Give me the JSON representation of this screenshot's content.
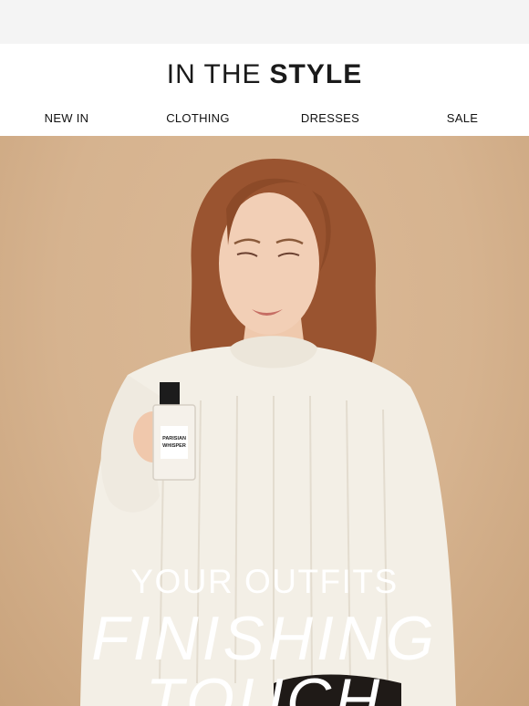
{
  "brand": {
    "logo_light": "IN THE",
    "logo_bold": "STYLE"
  },
  "nav": {
    "items": [
      "NEW IN",
      "CLOTHING",
      "DRESSES",
      "SALE"
    ]
  },
  "product": {
    "label_line1": "PARISIAN",
    "label_line2": "WHISPER"
  },
  "hero": {
    "headline_line1": "YOUR OUTFITS",
    "headline_line2": "FINISHING",
    "headline_line3": "TOUCH"
  },
  "colors": {
    "background": "#d6b38f",
    "sweater": "#f3efe6",
    "hair": "#9a5430",
    "text": "#ffffff"
  }
}
